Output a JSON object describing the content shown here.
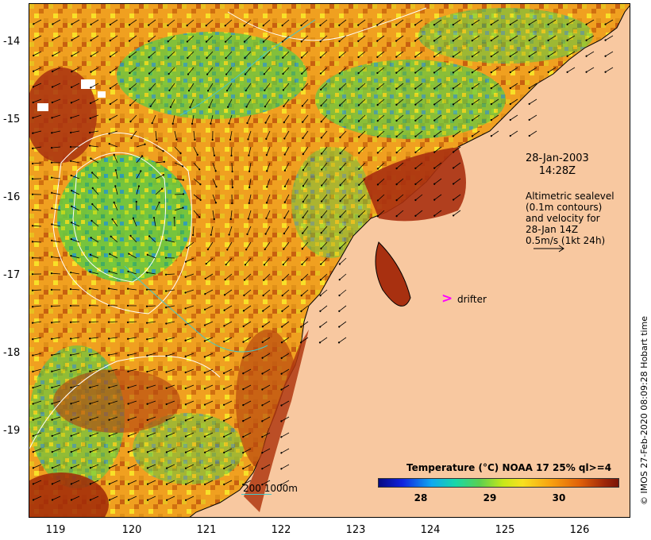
{
  "map": {
    "y_ticks": [
      "-14",
      "-15",
      "-16",
      "-17",
      "-18",
      "-19"
    ],
    "x_ticks": [
      "119",
      "120",
      "121",
      "122",
      "123",
      "124",
      "125",
      "126"
    ],
    "date_line1": "28-Jan-2003",
    "date_line2": "14:28Z",
    "sealevel_lines": [
      "Altimetric sealevel",
      "(0.1m contours)",
      "and velocity for",
      "28-Jan 14Z",
      "0.5m/s (1kt 24h)"
    ],
    "drifter_symbol": ">",
    "drifter_label": "drifter",
    "depth_legend": "200  1000m",
    "credit": "© IMOS 27-Feb-2020 08:09:28 Hobart time",
    "colors": {
      "land": "#f8c8a0",
      "drifter": "#ff00ff",
      "contour": "#ffffff",
      "bathymetry": "#45c8c8"
    }
  },
  "colorbar": {
    "title": "Temperature (°C) NOAA 17 25% ql>=4",
    "ticks": [
      "28",
      "29",
      "30"
    ]
  }
}
